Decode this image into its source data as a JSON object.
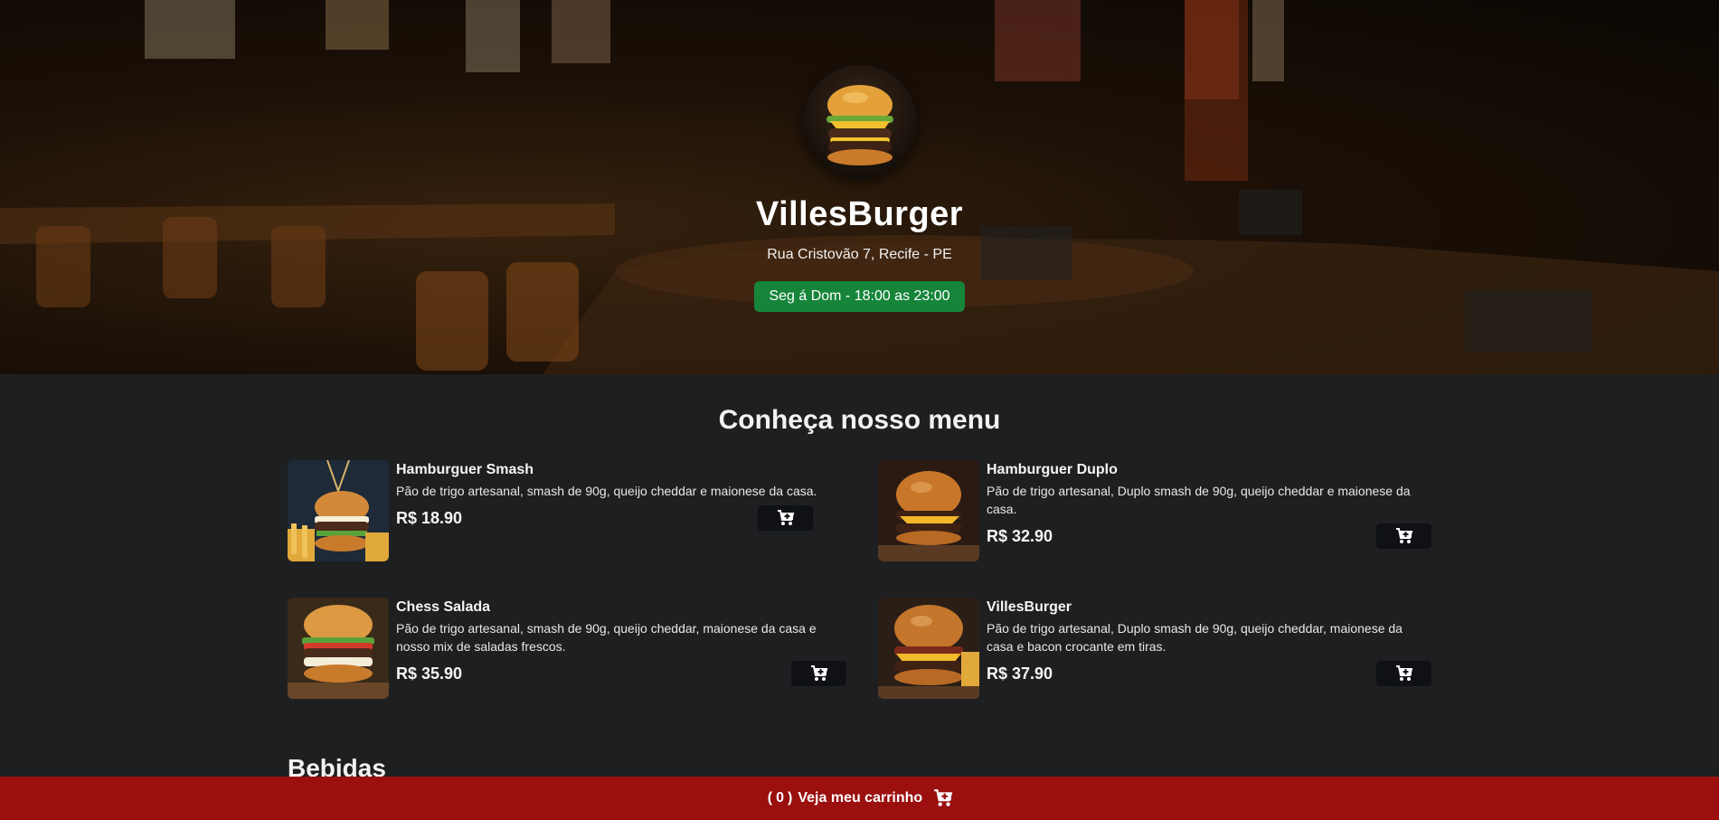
{
  "hero": {
    "brand": "VillesBurger",
    "address": "Rua Cristovão 7, Recife - PE",
    "hours": "Seg á Dom - 18:00 as 23:00"
  },
  "menu": {
    "title": "Conheça nosso menu",
    "items": [
      {
        "name": "Hamburguer Smash",
        "description": "Pão de trigo artesanal, smash de 90g, queijo cheddar e maionese da casa.",
        "price": "R$ 18.90",
        "image": "burger-with-fries-photo"
      },
      {
        "name": "Hamburguer Duplo",
        "description": "Pão de trigo artesanal, Duplo smash de 90g, queijo cheddar e maionese da casa.",
        "price": "R$ 32.90",
        "image": "double-burger-photo"
      },
      {
        "name": "Chess Salada",
        "description": "Pão de trigo artesanal, smash de 90g, queijo cheddar, maionese da casa e nosso mix de saladas frescos.",
        "price": "R$ 35.90",
        "image": "salad-burger-photo"
      },
      {
        "name": "VillesBurger",
        "description": "Pão de trigo artesanal, Duplo smash de 90g, queijo cheddar, maionese da casa e bacon crocante em tiras.",
        "price": "R$ 37.90",
        "image": "bacon-burger-photo"
      }
    ]
  },
  "drinks": {
    "title": "Bebidas"
  },
  "cart": {
    "open_paren": "(",
    "count": "0",
    "close_paren": ")",
    "label": "Veja meu carrinho",
    "icon": "cart-icon"
  },
  "colors": {
    "hours_badge": "#16853a",
    "cart_bar": "#9b0f0f",
    "page_bg": "#1e1f21",
    "button_bg": "#0f1117"
  }
}
